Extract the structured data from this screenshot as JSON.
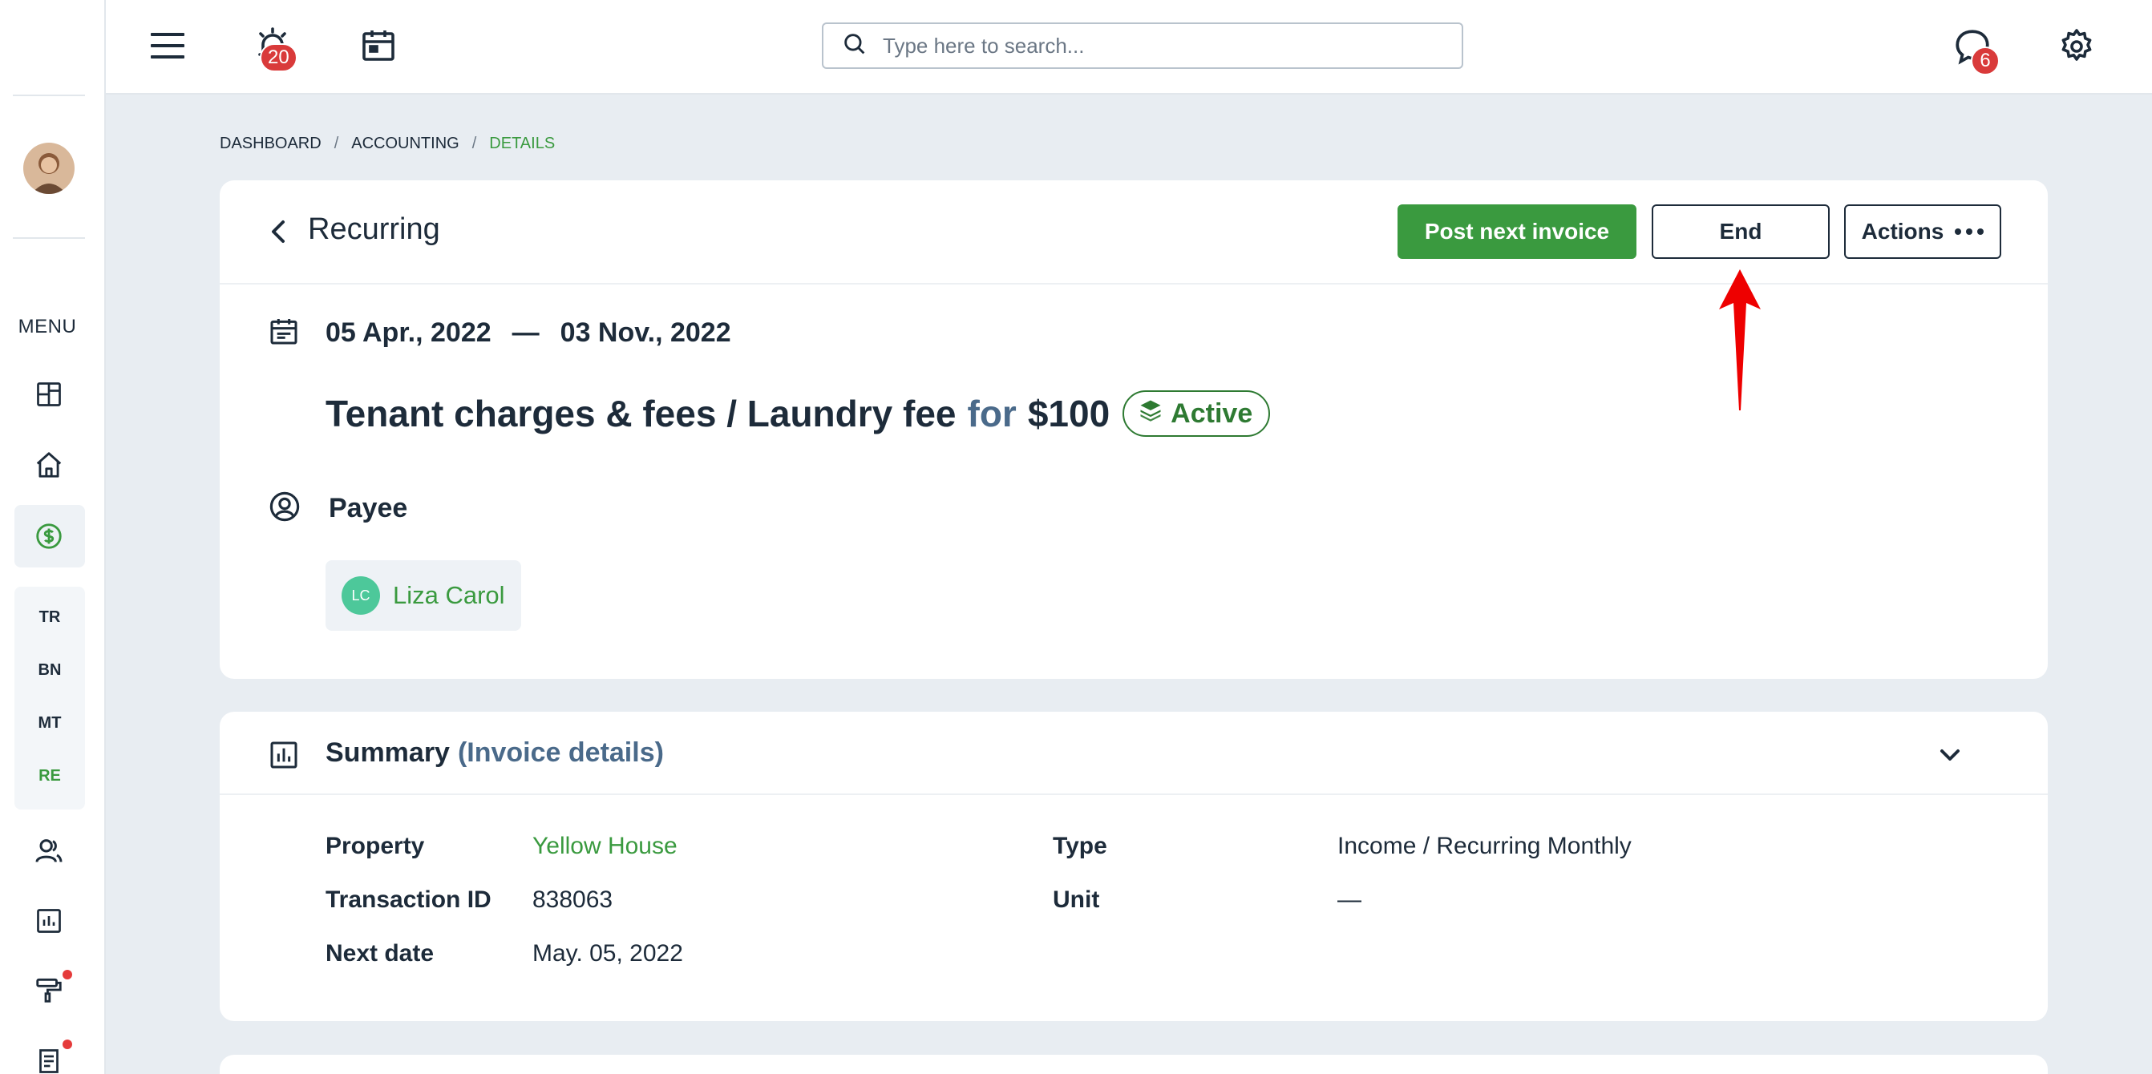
{
  "colors": {
    "accent": "#3a9a3f",
    "badge_red": "#d93a3a",
    "text": "#1d2b3a",
    "muted_blue": "#4a6a8a",
    "annotation": "#ee0000"
  },
  "topbar": {
    "alerts_count": "20",
    "messages_count": "6",
    "search_placeholder": "Type here to search..."
  },
  "sidebar": {
    "menu_label": "MENU",
    "icons": [
      "dashboard-icon",
      "home-icon",
      "dollar-icon",
      "users-icon",
      "chart-icon",
      "paint-roller-icon",
      "document-icon"
    ],
    "sub_items": [
      {
        "label": "TR",
        "active": false
      },
      {
        "label": "BN",
        "active": false
      },
      {
        "label": "MT",
        "active": false
      },
      {
        "label": "RE",
        "active": true
      }
    ]
  },
  "breadcrumb": {
    "items": [
      "DASHBOARD",
      "ACCOUNTING",
      "DETAILS"
    ],
    "separator": "/"
  },
  "recurring": {
    "title": "Recurring",
    "post_next_label": "Post next invoice",
    "end_label": "End",
    "actions_label": "Actions",
    "start_date": "05 Apr., 2022",
    "date_separator": "—",
    "end_date": "03 Nov., 2022",
    "charge_name": "Tenant charges & fees / Laundry fee",
    "for_word": "for",
    "amount": "$100",
    "status": "Active",
    "payee_label": "Payee",
    "payee_initials": "LC",
    "payee_name": "Liza Carol"
  },
  "summary": {
    "title": "Summary",
    "subtitle": "(Invoice details)",
    "property_label": "Property",
    "property_value": "Yellow House",
    "transaction_label": "Transaction ID",
    "transaction_value": "838063",
    "next_date_label": "Next date",
    "next_date_value": "May. 05, 2022",
    "type_label": "Type",
    "type_value": "Income / Recurring Monthly",
    "unit_label": "Unit",
    "unit_value": "—"
  }
}
